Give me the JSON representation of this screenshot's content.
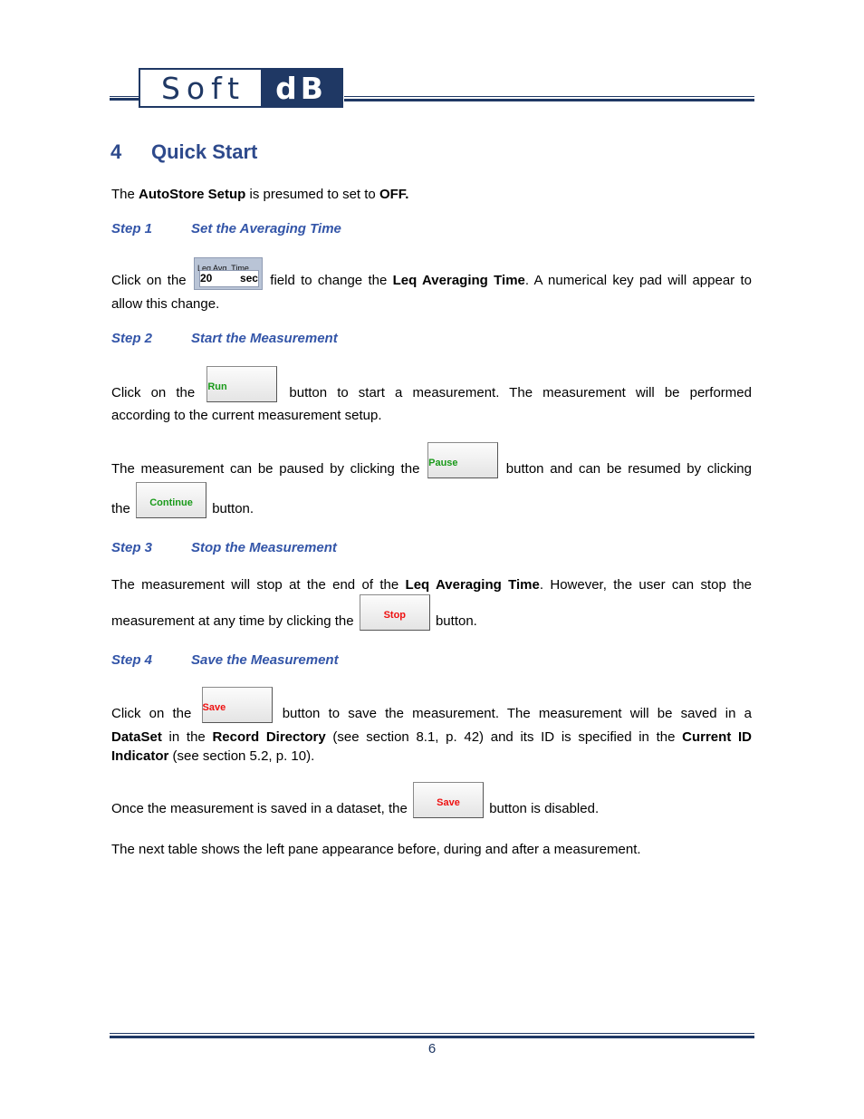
{
  "header": {
    "logo_left": "Soft",
    "logo_right": "dB"
  },
  "section": {
    "number": "4",
    "title": "Quick Start"
  },
  "intro": {
    "pre": "The ",
    "bold1": "AutoStore Setup",
    "mid": " is presumed to set to ",
    "bold2": "OFF."
  },
  "steps": [
    {
      "label": "Step 1",
      "title": "Set the Averaging Time"
    },
    {
      "label": "Step 2",
      "title": "Start the Measurement"
    },
    {
      "label": "Step 3",
      "title": "Stop the Measurement"
    },
    {
      "label": "Step 4",
      "title": "Save the Measurement"
    }
  ],
  "widgets": {
    "leq_label": "Leq Avg. Time",
    "leq_value": "20 sec",
    "run": "Run",
    "pause": "Pause",
    "continue": "Continue",
    "stop": "Stop",
    "save": "Save"
  },
  "text": {
    "s1_a": "Click on the ",
    "s1_b": " field to change the ",
    "s1_bold": "Leq Averaging Time",
    "s1_c": ". A numerical key pad will appear to",
    "s1_line2": "allow this change.",
    "s2_a": "Click on the ",
    "s2_b": " button to start a measurement. The measurement will be performed",
    "s2_line2": "according to the current measurement setup.",
    "pause_a": "The measurement can be paused by clicking the ",
    "pause_b": " button and can be resumed by clicking",
    "cont_a": "the ",
    "cont_b": " button.",
    "s3_a": "The measurement will stop at the end of the ",
    "s3_bold": "Leq Averaging Time",
    "s3_b": ". However, the user can stop the",
    "s3_c": "measurement at any time by clicking the ",
    "s3_d": " button.",
    "s4_a": "Click on the ",
    "s4_b": " button to save the measurement. The measurement will be saved in a",
    "s4_bold1": "DataSet",
    "s4_c": " in the ",
    "s4_bold2": "Record Directory",
    "s4_d": " (see section 8.1, p. 42) and its ID is specified in the ",
    "s4_bold3": "Current ID",
    "s4_bold4": "Indicator",
    "s4_e": " (see section 5.2, p. 10).",
    "saved_a": "Once the measurement is saved in a dataset, the ",
    "saved_b": " button is disabled.",
    "table_note": "The next table shows the left pane appearance before, during and after a measurement."
  },
  "footer": {
    "page_number": "6"
  }
}
